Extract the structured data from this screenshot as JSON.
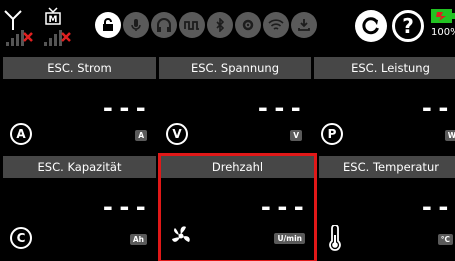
{
  "status": {
    "battery_percent": "100%",
    "icons": [
      "antenna-signal-icon",
      "receiver-signal-icon",
      "lock-icon",
      "microphone-icon",
      "headphones-icon",
      "servo-icon",
      "bluetooth-icon",
      "settings-icon",
      "wifi-icon",
      "download-icon",
      "reset-icon",
      "help-icon",
      "battery-icon"
    ],
    "help_glyph": "?"
  },
  "tiles": [
    {
      "title": "ESC. Strom",
      "value": "---",
      "unit": "A",
      "icon": "A"
    },
    {
      "title": "ESC. Spannung",
      "value": "---",
      "unit": "V",
      "icon": "V"
    },
    {
      "title": "ESC. Leistung",
      "value": "---",
      "unit": "W",
      "icon": "P"
    },
    {
      "title": "ESC. Kapazität",
      "value": "---",
      "unit": "Ah",
      "icon": "C"
    },
    {
      "title": "Drehzahl",
      "value": "---",
      "unit": "U/min",
      "icon": "fan-icon"
    },
    {
      "title": "ESC. Temperatur",
      "value": "---",
      "unit": "°C",
      "icon": "thermometer-icon"
    }
  ],
  "colors": {
    "header_bg": "#474747",
    "selected_border": "#e01818",
    "unit_badge": "#5a5a5a",
    "battery_green": "#22c322",
    "battery_red": "#e02020"
  }
}
